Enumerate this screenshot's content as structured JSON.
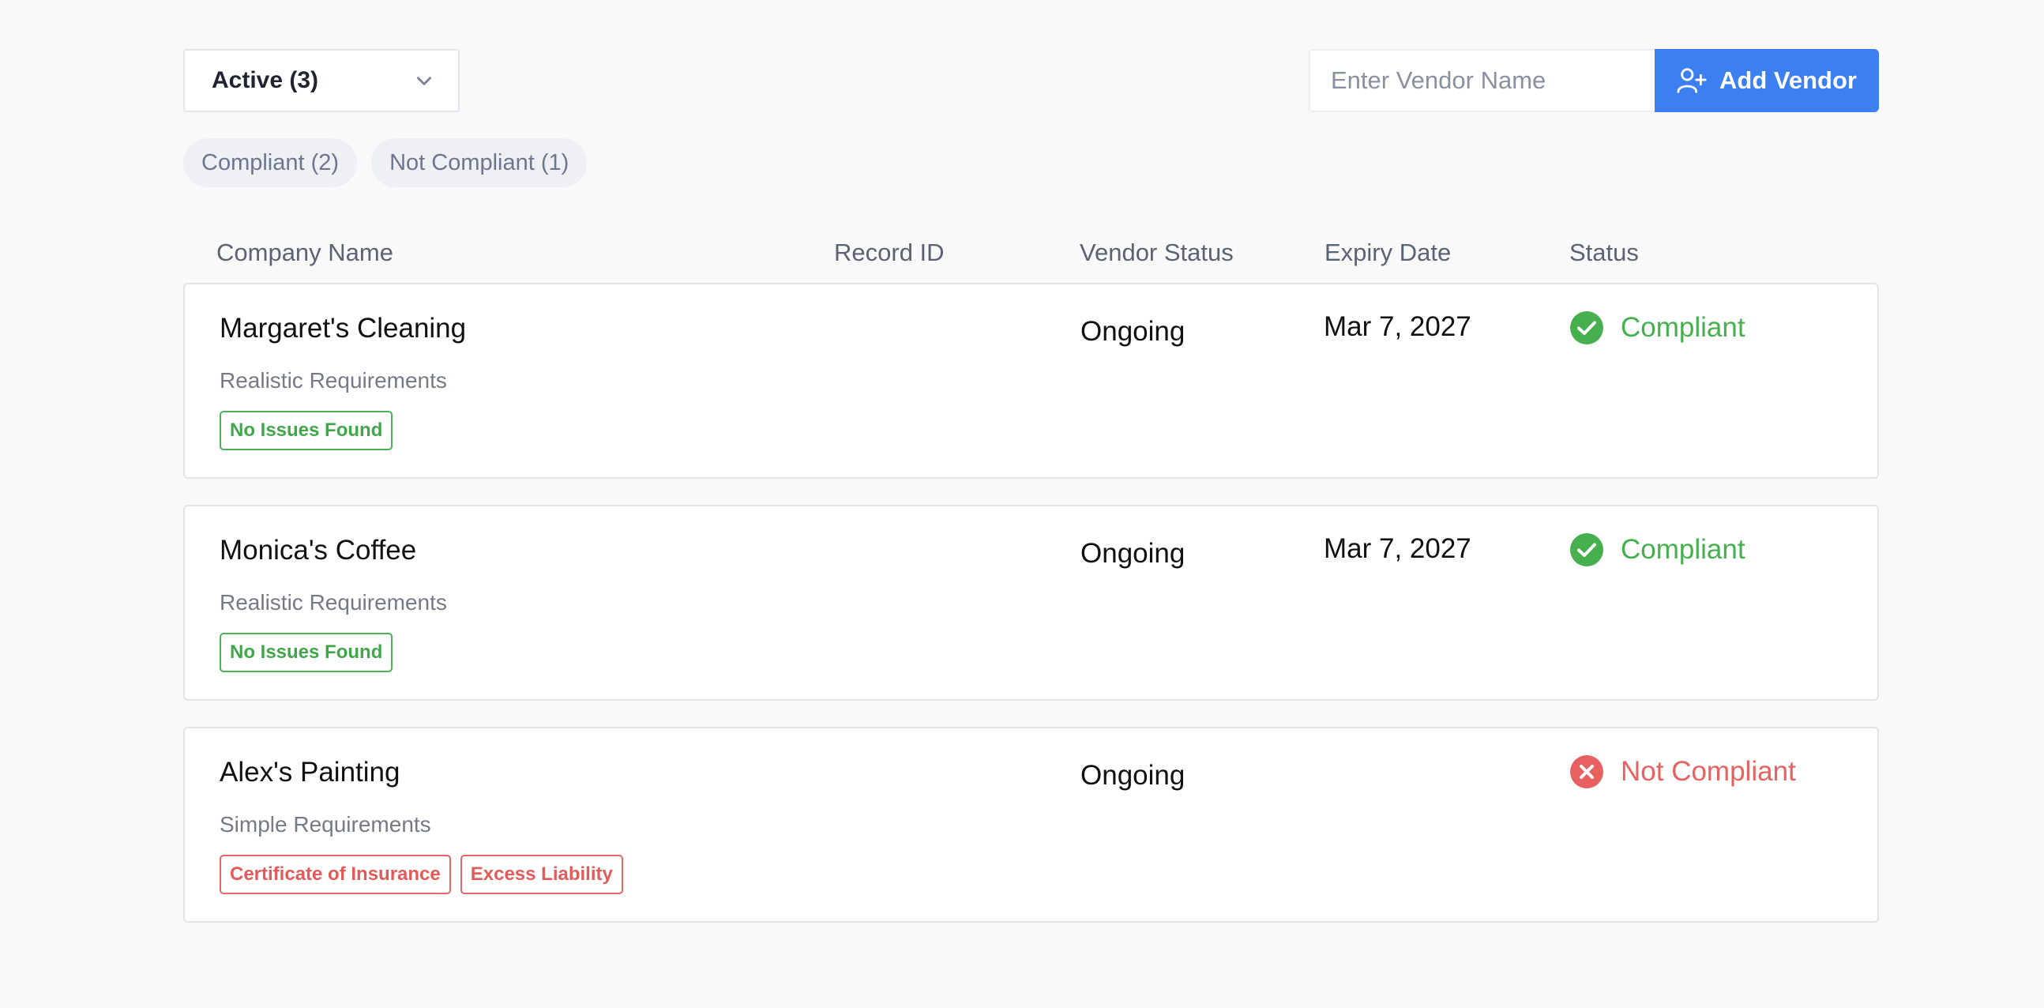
{
  "toolbar": {
    "filter_selected": "Active (3)",
    "search_placeholder": "Enter Vendor Name",
    "add_vendor_label": "Add Vendor",
    "accent_color": "#3b7ff0"
  },
  "chips": [
    {
      "label": "Compliant (2)"
    },
    {
      "label": "Not Compliant (1)"
    }
  ],
  "table": {
    "headers": {
      "company": "Company Name",
      "record_id": "Record ID",
      "vendor_status": "Vendor Status",
      "expiry": "Expiry Date",
      "status": "Status"
    },
    "rows": [
      {
        "company": "Margaret's Cleaning",
        "requirements": "Realistic Requirements",
        "tags": [
          "No Issues Found"
        ],
        "vendor_status": "Ongoing",
        "expiry": "Mar 7, 2027",
        "status": "Compliant",
        "status_icon": "check-circle-icon",
        "status_color": "#46b04f"
      },
      {
        "company": "Monica's Coffee",
        "requirements": "Realistic Requirements",
        "tags": [
          "No Issues Found"
        ],
        "vendor_status": "Ongoing",
        "expiry": "Mar 7, 2027",
        "status": "Compliant",
        "status_icon": "check-circle-icon",
        "status_color": "#46b04f"
      },
      {
        "company": "Alex's Painting",
        "requirements": "Simple Requirements",
        "tags": [
          "Certificate of Insurance",
          "Excess Liability"
        ],
        "vendor_status": "Ongoing",
        "expiry": "",
        "status": "Not Compliant",
        "status_icon": "x-circle-icon",
        "status_color": "#e86161"
      }
    ]
  }
}
